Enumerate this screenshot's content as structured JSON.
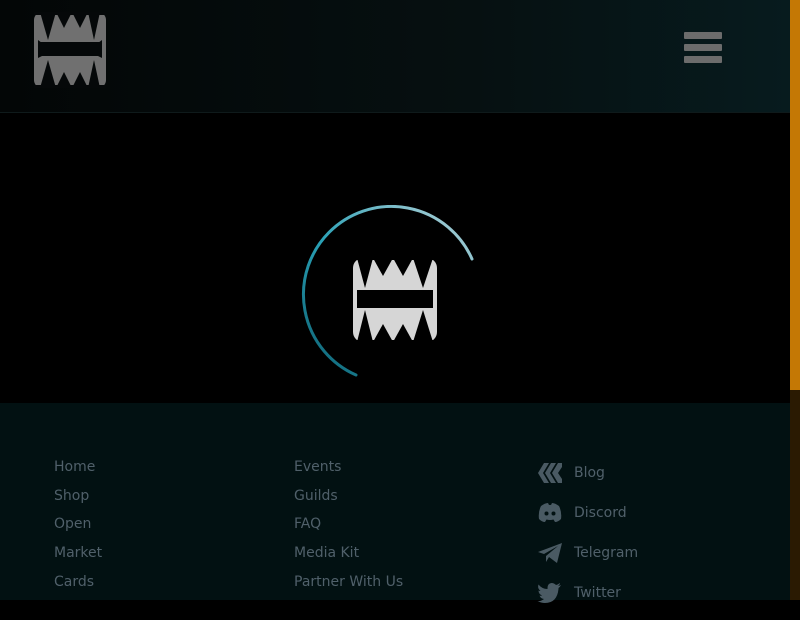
{
  "header": {
    "logo_icon": "fangs-logo-icon",
    "menu_icon": "hamburger-menu-icon"
  },
  "loader": {
    "icon": "fangs-spinner-icon",
    "arc_color": "#2aa1b6"
  },
  "footer": {
    "col1": [
      "Home",
      "Shop",
      "Open",
      "Market",
      "Cards"
    ],
    "col2": [
      "Events",
      "Guilds",
      "FAQ",
      "Media Kit",
      "Partner With Us"
    ],
    "social": [
      {
        "label": "Blog",
        "icon": "hive-blog-icon"
      },
      {
        "label": "Discord",
        "icon": "discord-icon"
      },
      {
        "label": "Telegram",
        "icon": "telegram-icon"
      },
      {
        "label": "Twitter",
        "icon": "twitter-icon"
      }
    ]
  },
  "colors": {
    "accent_scroll": "#c47805",
    "footer_bg": "#021112",
    "link": "#50606a"
  }
}
